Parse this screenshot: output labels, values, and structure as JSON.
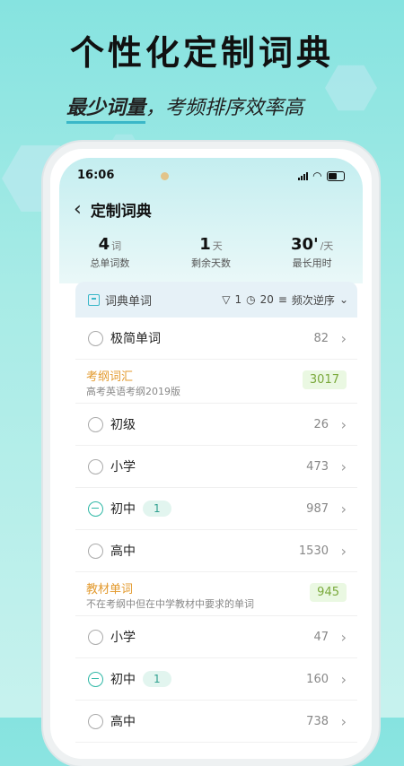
{
  "promo": {
    "headline": "个性化定制词典",
    "sub_highlight": "最少词量",
    "sub_rest": "，考频排序效率高"
  },
  "status_bar": {
    "time": "16:06"
  },
  "nav": {
    "back_icon": "chevron-left-icon",
    "title": "定制词典"
  },
  "stats": [
    {
      "value": "4",
      "unit": "词",
      "label": "总单词数"
    },
    {
      "value": "1",
      "unit": "天",
      "label": "剩余天数"
    },
    {
      "value": "30'",
      "unit": "/天",
      "label": "最长用时"
    }
  ],
  "filter_bar": {
    "label": "词典单词",
    "filter_count": "1",
    "time_value": "20",
    "sort_label": "频次逆序"
  },
  "list": [
    {
      "kind": "row",
      "label": "极简单词",
      "count": "82",
      "selected": "none",
      "pill": ""
    },
    {
      "kind": "section",
      "title": "考纲词汇",
      "subtitle": "高考英语考纲2019版",
      "badge": "3017"
    },
    {
      "kind": "row",
      "label": "初级",
      "count": "26",
      "selected": "none",
      "pill": ""
    },
    {
      "kind": "row",
      "label": "小学",
      "count": "473",
      "selected": "none",
      "pill": ""
    },
    {
      "kind": "row",
      "label": "初中",
      "count": "987",
      "selected": "partial",
      "pill": "1"
    },
    {
      "kind": "row",
      "label": "高中",
      "count": "1530",
      "selected": "none",
      "pill": ""
    },
    {
      "kind": "section",
      "title": "教材单词",
      "subtitle": "不在考纲中但在中学教材中要求的单词",
      "badge": "945"
    },
    {
      "kind": "row",
      "label": "小学",
      "count": "47",
      "selected": "none",
      "pill": ""
    },
    {
      "kind": "row",
      "label": "初中",
      "count": "160",
      "selected": "partial",
      "pill": "1"
    },
    {
      "kind": "row",
      "label": "高中",
      "count": "738",
      "selected": "none",
      "pill": ""
    }
  ],
  "colors": {
    "accent": "#2fb8a6",
    "section_title": "#e39a2e",
    "badge_text": "#7aa93b"
  }
}
